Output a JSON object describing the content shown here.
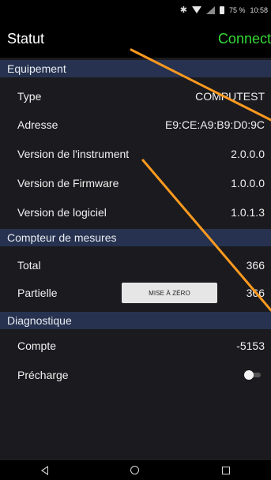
{
  "status_bar": {
    "battery": "75 %",
    "time": "10:58"
  },
  "header": {
    "title": "Statut",
    "connection_status": "Connecté",
    "connection_color": "#35d836"
  },
  "sections": {
    "equipment": {
      "title": "Equipement",
      "rows": [
        {
          "label": "Type",
          "value": "COMPUTEST"
        },
        {
          "label": "Adresse",
          "value": "E9:CE:A9:B9:D0:9C"
        },
        {
          "label": "Version de l'instrument",
          "value": "2.0.0.0"
        },
        {
          "label": "Version de Firmware",
          "value": "1.0.0.0"
        },
        {
          "label": "Version de logiciel",
          "value": "1.0.1.3"
        }
      ]
    },
    "counter": {
      "title": "Compteur de mesures",
      "rows": [
        {
          "label": "Total",
          "value": "366"
        },
        {
          "label": "Partielle",
          "value": "366"
        }
      ],
      "reset_label": "MISE À ZÉRO"
    },
    "diagnostic": {
      "title": "Diagnostique",
      "rows": [
        {
          "label": "Compte",
          "value": "-5153"
        },
        {
          "label": "Précharge",
          "value": ""
        }
      ],
      "precharge_on": false
    }
  },
  "nav": {
    "back_icon": "back-triangle-icon",
    "home_icon": "home-circle-icon",
    "recent_icon": "recent-square-icon"
  },
  "colors": {
    "section_bg": "#26324f",
    "annotation_line": "#ff9a1f"
  }
}
